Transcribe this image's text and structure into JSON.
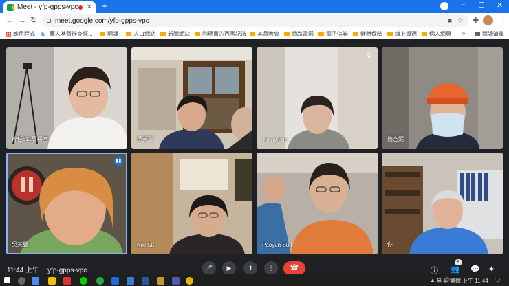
{
  "browser": {
    "tab_title": "Meet - yfp-gpps-vpc",
    "url": "meet.google.com/yfp-gpps-vpc",
    "back_icon": "arrow-left-icon",
    "forward_icon": "arrow-right-icon",
    "reload_icon": "reload-icon",
    "new_tab_label": "+"
  },
  "bookmarks": {
    "items": [
      "應用程式",
      "華人基督徒查經...",
      "翻譯",
      "人口網站",
      "新聞網站",
      "利瑪竇的西國記法",
      "基督教會",
      "網路電影",
      "電子信箱",
      "健財保險",
      "線上資源",
      "個人網頁"
    ],
    "more_label": "»",
    "reading_list": "閱讀清單"
  },
  "participants": [
    {
      "name": "梓任611晨禱室",
      "muted": false,
      "bg": "#dcd6cf"
    },
    {
      "name": "吳芙麗",
      "muted": false,
      "bg": "#6e6357"
    },
    {
      "name": "Jenny Luo",
      "muted": true,
      "bg": "#d9d4ce"
    },
    {
      "name": "簡杏妮",
      "muted": false,
      "bg": "#8d8983"
    },
    {
      "name": "吳美麗",
      "muted": false,
      "bg": "#5b5043",
      "speaking": true
    },
    {
      "name": "Kiki Su",
      "muted": false,
      "bg": "#c9bfae"
    },
    {
      "name": "Paoyun Sun",
      "muted": false,
      "bg": "#a59b91"
    },
    {
      "name": "你",
      "muted": false,
      "bg": "#a7a29b"
    }
  ],
  "meeting": {
    "time": "11:44 上午",
    "code": "yfp-gpps-vpc",
    "people_count": "8"
  },
  "taskbar": {
    "lang": "繁體",
    "time": "上午 11:44"
  }
}
